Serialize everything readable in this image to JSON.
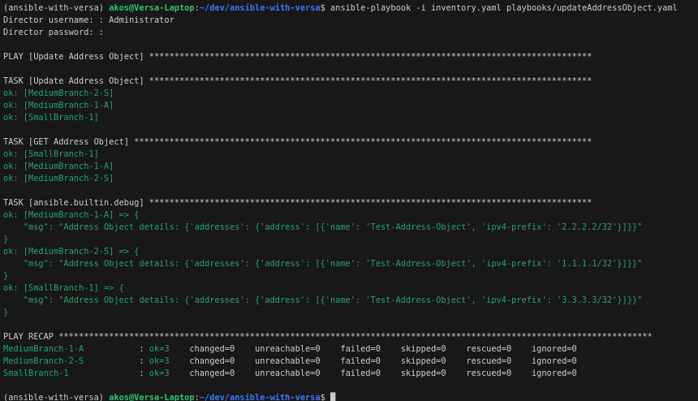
{
  "colors": {
    "background": "#181818",
    "foreground": "#cccccc",
    "ansible_ok_green": "#26a269",
    "prompt_user_green": "#2fc272",
    "prompt_path_blue": "#3b78ff",
    "cursor": "#c8c8c8"
  },
  "terminal": {
    "lines": [
      {
        "segments": [
          {
            "text": "(ansible-with-versa) ",
            "color": "fg"
          },
          {
            "text": "akos@Versa-Laptop",
            "color": "pgreen"
          },
          {
            "text": ":",
            "color": "fg"
          },
          {
            "text": "~/dev/ansible-with-versa",
            "color": "pblue"
          },
          {
            "text": "$ ansible-playbook -i inventory.yaml playbooks/updateAddressObject.yaml",
            "color": "fg"
          }
        ]
      },
      {
        "segments": [
          {
            "text": "Director username: : Administrator",
            "color": "fg"
          }
        ]
      },
      {
        "segments": [
          {
            "text": "Director password: :",
            "color": "fg"
          }
        ]
      },
      {
        "segments": []
      },
      {
        "segments": [
          {
            "text": "PLAY [Update Address Object] ****************************************************************************************",
            "color": "fg"
          }
        ]
      },
      {
        "segments": []
      },
      {
        "segments": [
          {
            "text": "TASK [Update Address Object] ****************************************************************************************",
            "color": "fg"
          }
        ]
      },
      {
        "segments": [
          {
            "text": "ok: [MediumBranch-2-S]",
            "color": "green"
          }
        ]
      },
      {
        "segments": [
          {
            "text": "ok: [MediumBranch-1-A]",
            "color": "green"
          }
        ]
      },
      {
        "segments": [
          {
            "text": "ok: [SmallBranch-1]",
            "color": "green"
          }
        ]
      },
      {
        "segments": []
      },
      {
        "segments": [
          {
            "text": "TASK [GET Address Object] *******************************************************************************************",
            "color": "fg"
          }
        ]
      },
      {
        "segments": [
          {
            "text": "ok: [SmallBranch-1]",
            "color": "green"
          }
        ]
      },
      {
        "segments": [
          {
            "text": "ok: [MediumBranch-1-A]",
            "color": "green"
          }
        ]
      },
      {
        "segments": [
          {
            "text": "ok: [MediumBranch-2-S]",
            "color": "green"
          }
        ]
      },
      {
        "segments": []
      },
      {
        "segments": [
          {
            "text": "TASK [ansible.builtin.debug] ****************************************************************************************",
            "color": "fg"
          }
        ]
      },
      {
        "segments": [
          {
            "text": "ok: [MediumBranch-1-A] => {",
            "color": "green"
          }
        ]
      },
      {
        "segments": [
          {
            "text": "    \"msg\": \"Address Object details: {'addresses': {'address': [{'name': 'Test-Address-Object', 'ipv4-prefix': '2.2.2.2/32'}]}}\"",
            "color": "green"
          }
        ]
      },
      {
        "segments": [
          {
            "text": "}",
            "color": "green"
          }
        ]
      },
      {
        "segments": [
          {
            "text": "ok: [MediumBranch-2-S] => {",
            "color": "green"
          }
        ]
      },
      {
        "segments": [
          {
            "text": "    \"msg\": \"Address Object details: {'addresses': {'address': [{'name': 'Test-Address-Object', 'ipv4-prefix': '1.1.1.1/32'}]}}\"",
            "color": "green"
          }
        ]
      },
      {
        "segments": [
          {
            "text": "}",
            "color": "green"
          }
        ]
      },
      {
        "segments": [
          {
            "text": "ok: [SmallBranch-1] => {",
            "color": "green"
          }
        ]
      },
      {
        "segments": [
          {
            "text": "    \"msg\": \"Address Object details: {'addresses': {'address': [{'name': 'Test-Address-Object', 'ipv4-prefix': '3.3.3.3/32'}]}}\"",
            "color": "green"
          }
        ]
      },
      {
        "segments": [
          {
            "text": "}",
            "color": "green"
          }
        ]
      },
      {
        "segments": []
      },
      {
        "segments": [
          {
            "text": "PLAY RECAP **********************************************************************************************************************",
            "color": "fg"
          }
        ]
      },
      {
        "segments": [
          {
            "text": "MediumBranch-1-A",
            "color": "green"
          },
          {
            "text": "           : ",
            "color": "fg"
          },
          {
            "text": "ok=3",
            "color": "green"
          },
          {
            "text": "    changed=0    unreachable=0    failed=0    skipped=0    rescued=0    ignored=0",
            "color": "fg"
          }
        ]
      },
      {
        "segments": [
          {
            "text": "MediumBranch-2-S",
            "color": "green"
          },
          {
            "text": "           : ",
            "color": "fg"
          },
          {
            "text": "ok=3",
            "color": "green"
          },
          {
            "text": "    changed=0    unreachable=0    failed=0    skipped=0    rescued=0    ignored=0",
            "color": "fg"
          }
        ]
      },
      {
        "segments": [
          {
            "text": "SmallBranch-1",
            "color": "green"
          },
          {
            "text": "              : ",
            "color": "fg"
          },
          {
            "text": "ok=3",
            "color": "green"
          },
          {
            "text": "    changed=0    unreachable=0    failed=0    skipped=0    rescued=0    ignored=0",
            "color": "fg"
          }
        ]
      },
      {
        "segments": []
      },
      {
        "segments": [
          {
            "text": "(ansible-with-versa) ",
            "color": "fg"
          },
          {
            "text": "akos@Versa-Laptop",
            "color": "pgreen"
          },
          {
            "text": ":",
            "color": "fg"
          },
          {
            "text": "~/dev/ansible-with-versa",
            "color": "pblue"
          },
          {
            "text": "$ ",
            "color": "fg"
          },
          {
            "text": "█",
            "color": "cursor",
            "name": "terminal-cursor"
          }
        ]
      }
    ]
  }
}
